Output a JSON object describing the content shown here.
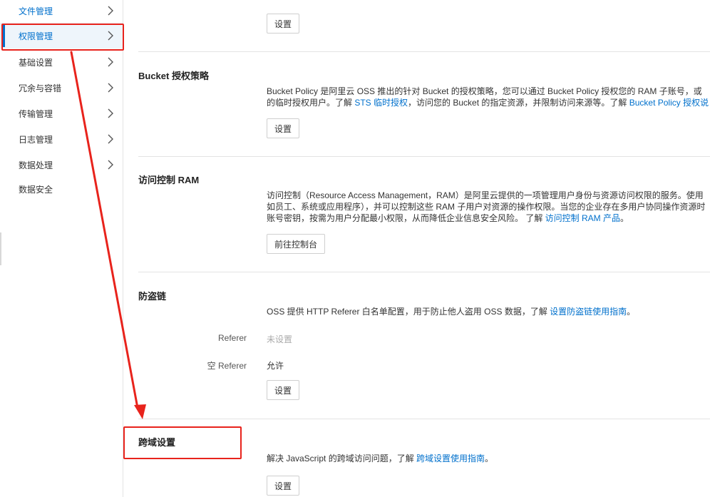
{
  "sidebar": {
    "items": [
      {
        "label": "文件管理"
      },
      {
        "label": "权限管理"
      },
      {
        "label": "基础设置"
      },
      {
        "label": "冗余与容错"
      },
      {
        "label": "传输管理"
      },
      {
        "label": "日志管理"
      },
      {
        "label": "数据处理"
      },
      {
        "label": "数据安全"
      }
    ]
  },
  "top_section": {
    "button": "设置"
  },
  "bucket_policy": {
    "title": "Bucket 授权策略",
    "line1": "Bucket Policy 是阿里云 OSS 推出的针对 Bucket 的授权策略，您可以通过 Bucket Policy 授权您的 RAM 子账号，或",
    "line2_prefix": "的临时授权用户。了解 ",
    "line2_link1": "STS 临时授权",
    "line2_mid": "，访问您的 Bucket 的指定资源，并限制访问来源等。了解 ",
    "line2_link2": "Bucket Policy 授权说",
    "button": "设置"
  },
  "ram": {
    "title": "访问控制 RAM",
    "line1": "访问控制（Resource Access Management，RAM）是阿里云提供的一项管理用户身份与资源访问权限的服务。使用",
    "line2": "如员工、系统或应用程序），并可以控制这些 RAM 子用户对资源的操作权限。当您的企业存在多用户协同操作资源时",
    "line3_prefix": "账号密钥，按需为用户分配最小权限，从而降低企业信息安全风险。 了解 ",
    "line3_link": "访问控制 RAM 产品",
    "line3_suffix": "。",
    "button": "前往控制台"
  },
  "hotlink": {
    "title": "防盗链",
    "desc_prefix": "OSS 提供 HTTP Referer 白名单配置，用于防止他人盗用 OSS 数据，了解 ",
    "desc_link": "设置防盗链使用指南",
    "desc_suffix": "。",
    "referer_label": "Referer",
    "referer_value": "未设置",
    "empty_referer_label": "空 Referer",
    "empty_referer_value": "允许",
    "button": "设置"
  },
  "cors": {
    "title": "跨域设置",
    "desc_prefix": "解决 JavaScript 的跨域访问问题，了解 ",
    "desc_link": "跨域设置使用指南",
    "desc_suffix": "。",
    "button": "设置"
  },
  "colors": {
    "accent": "#0070cc",
    "annotation": "#e8231c"
  }
}
